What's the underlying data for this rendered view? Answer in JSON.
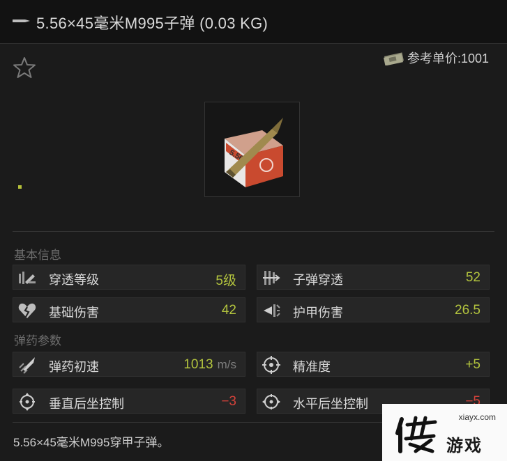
{
  "header": {
    "icon": "bullet-icon",
    "title": "5.56×45毫米M995子弹 (0.03 KG)"
  },
  "price": {
    "icon": "money-stack-icon",
    "text": "参考单价:1001"
  },
  "favorite": {
    "icon": "star-outline-icon"
  },
  "item_image": {
    "icon": "ammo-box-icon"
  },
  "sections": {
    "basic": "基本信息",
    "ammo": "弹药参数"
  },
  "stats": {
    "penetration_level": {
      "label": "穿透等级",
      "value": "5级",
      "color": "#b3c43e",
      "icon": "penetration-level-icon"
    },
    "bullet_penetration": {
      "label": "子弹穿透",
      "value": "52",
      "color": "#b3c43e",
      "icon": "bullet-penetration-icon"
    },
    "base_damage": {
      "label": "基础伤害",
      "value": "42",
      "color": "#b3c43e",
      "icon": "broken-heart-icon"
    },
    "armor_damage": {
      "label": "护甲伤害",
      "value": "26.5",
      "color": "#b3c43e",
      "icon": "armor-damage-icon"
    },
    "muzzle_velocity": {
      "label": "弹药初速",
      "value": "1013",
      "unit": "m/s",
      "color": "#b3c43e",
      "icon": "velocity-icon"
    },
    "accuracy": {
      "label": "精准度",
      "value": "+5",
      "color": "#b3c43e",
      "icon": "crosshair-icon"
    },
    "vertical_recoil": {
      "label": "垂直后坐控制",
      "value": "−3",
      "color": "#d4423a",
      "icon": "vertical-recoil-icon"
    },
    "horizontal_recoil": {
      "label": "水平后坐控制",
      "value": "−5",
      "color": "#d4423a",
      "icon": "horizontal-recoil-icon"
    }
  },
  "description": "5.56×45毫米M995穿甲子弹。",
  "watermark": {
    "url": "xiayx.com",
    "text": "游戏",
    "icon": "xia-logo"
  }
}
